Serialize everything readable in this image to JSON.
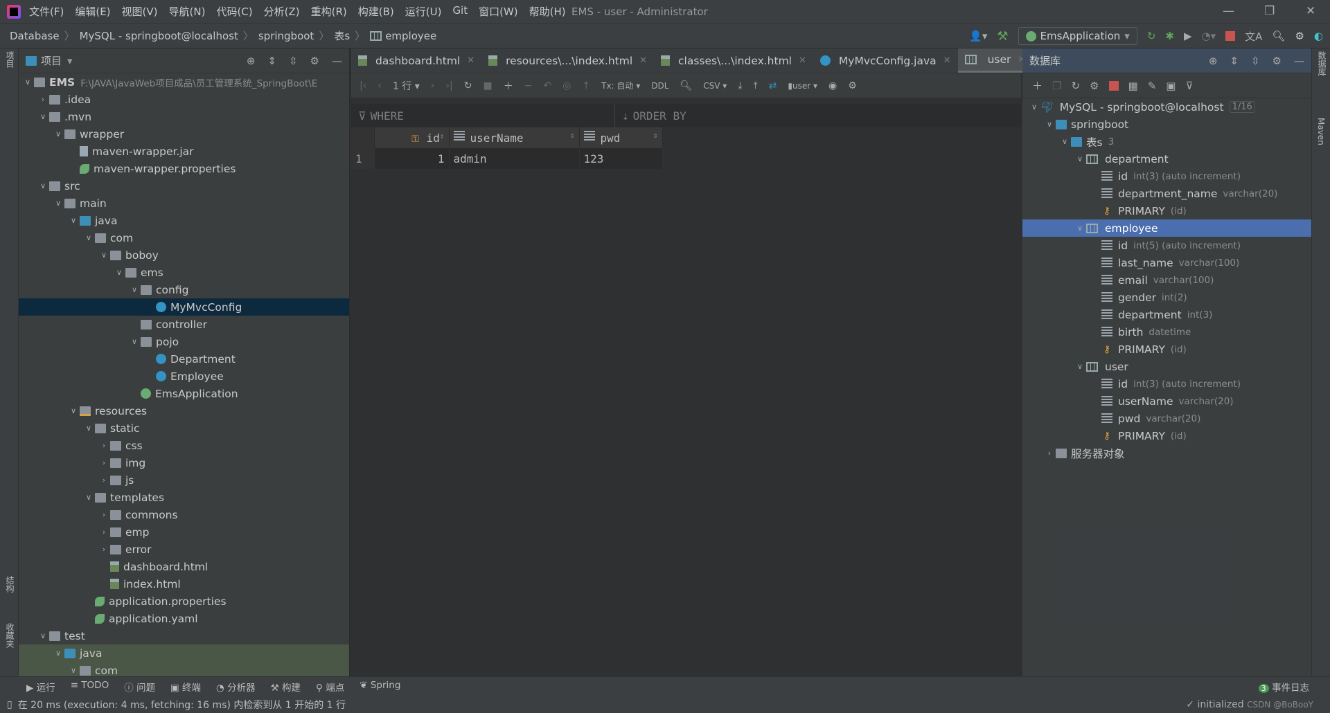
{
  "menu": [
    "文件(F)",
    "编辑(E)",
    "视图(V)",
    "导航(N)",
    "代码(C)",
    "分析(Z)",
    "重构(R)",
    "构建(B)",
    "运行(U)",
    "Git",
    "窗口(W)",
    "帮助(H)"
  ],
  "window_title": "EMS - user - Administrator",
  "breadcrumb": [
    "Database",
    "MySQL - springboot@localhost",
    "springboot",
    "表s",
    "employee"
  ],
  "run_config": "EmsApplication",
  "left_strip": {
    "project": "项目",
    "structure": "结构",
    "favorites": "收藏夹"
  },
  "right_strip": {
    "database": "数据库",
    "maven": "Maven"
  },
  "project": {
    "title": "项目",
    "root": {
      "name": "EMS",
      "path": "F:\\JAVA\\JavaWeb项目成品\\员工管理系统_SpringBoot\\E"
    },
    "items": [
      {
        "name": ".idea",
        "depth": 1,
        "type": "folder",
        "state": "collapsed"
      },
      {
        "name": ".mvn",
        "depth": 1,
        "type": "folder",
        "state": "expanded"
      },
      {
        "name": "wrapper",
        "depth": 2,
        "type": "folder",
        "state": "expanded"
      },
      {
        "name": "maven-wrapper.jar",
        "depth": 3,
        "type": "file"
      },
      {
        "name": "maven-wrapper.properties",
        "depth": 3,
        "type": "props"
      },
      {
        "name": "src",
        "depth": 1,
        "type": "folder",
        "state": "expanded"
      },
      {
        "name": "main",
        "depth": 2,
        "type": "folder",
        "state": "expanded"
      },
      {
        "name": "java",
        "depth": 3,
        "type": "srcfolder",
        "state": "expanded"
      },
      {
        "name": "com",
        "depth": 4,
        "type": "package",
        "state": "expanded"
      },
      {
        "name": "boboy",
        "depth": 5,
        "type": "package",
        "state": "expanded"
      },
      {
        "name": "ems",
        "depth": 6,
        "type": "package",
        "state": "expanded"
      },
      {
        "name": "config",
        "depth": 7,
        "type": "package",
        "state": "expanded"
      },
      {
        "name": "MyMvcConfig",
        "depth": 8,
        "type": "class",
        "selected": true
      },
      {
        "name": "controller",
        "depth": 7,
        "type": "package"
      },
      {
        "name": "pojo",
        "depth": 7,
        "type": "package",
        "state": "expanded"
      },
      {
        "name": "Department",
        "depth": 8,
        "type": "class"
      },
      {
        "name": "Employee",
        "depth": 8,
        "type": "class"
      },
      {
        "name": "EmsApplication",
        "depth": 7,
        "type": "spring"
      },
      {
        "name": "resources",
        "depth": 3,
        "type": "resfolder",
        "state": "expanded"
      },
      {
        "name": "static",
        "depth": 4,
        "type": "folder",
        "state": "expanded"
      },
      {
        "name": "css",
        "depth": 5,
        "type": "folder",
        "state": "collapsed"
      },
      {
        "name": "img",
        "depth": 5,
        "type": "folder",
        "state": "collapsed"
      },
      {
        "name": "js",
        "depth": 5,
        "type": "folder",
        "state": "collapsed"
      },
      {
        "name": "templates",
        "depth": 4,
        "type": "folder",
        "state": "expanded"
      },
      {
        "name": "commons",
        "depth": 5,
        "type": "folder",
        "state": "collapsed"
      },
      {
        "name": "emp",
        "depth": 5,
        "type": "folder",
        "state": "collapsed"
      },
      {
        "name": "error",
        "depth": 5,
        "type": "folder",
        "state": "collapsed"
      },
      {
        "name": "dashboard.html",
        "depth": 5,
        "type": "html"
      },
      {
        "name": "index.html",
        "depth": 5,
        "type": "html"
      },
      {
        "name": "application.properties",
        "depth": 4,
        "type": "props"
      },
      {
        "name": "application.yaml",
        "depth": 4,
        "type": "props"
      },
      {
        "name": "test",
        "depth": 1,
        "type": "folder",
        "state": "expanded"
      },
      {
        "name": "java",
        "depth": 2,
        "type": "srcfolder",
        "state": "expanded",
        "test": true
      },
      {
        "name": "com",
        "depth": 3,
        "type": "package",
        "state": "expanded",
        "test": true
      }
    ]
  },
  "tabs": [
    {
      "label": "dashboard.html",
      "icon": "html-file-icon"
    },
    {
      "label": "resources\\...\\index.html",
      "icon": "html-file-icon"
    },
    {
      "label": "classes\\...\\index.html",
      "icon": "html-file-icon"
    },
    {
      "label": "MyMvcConfig.java",
      "icon": "class-icon"
    },
    {
      "label": "user",
      "icon": "table-icon",
      "active": true
    }
  ],
  "grid_toolbar": {
    "rows": "1 行",
    "tx": "Tx: 自动",
    "ddl": "DDL",
    "format": "CSV",
    "schema": "user"
  },
  "filters": {
    "where": "WHERE",
    "order_by": "ORDER BY"
  },
  "grid": {
    "columns": [
      "id",
      "userName",
      "pwd"
    ],
    "rows": [
      [
        "1",
        "1",
        "admin",
        "123"
      ]
    ]
  },
  "database": {
    "title": "数据库",
    "connection": "MySQL - springboot@localhost",
    "connection_badge": "1/16",
    "schema": "springboot",
    "tables_label": "表s",
    "tables_count": "3",
    "tables": [
      {
        "name": "department",
        "columns": [
          {
            "name": "id",
            "type": "int(3) (auto increment)",
            "pk": true
          },
          {
            "name": "department_name",
            "type": "varchar(20)"
          }
        ],
        "key": {
          "name": "PRIMARY",
          "cols": "(id)"
        }
      },
      {
        "name": "employee",
        "selected": true,
        "columns": [
          {
            "name": "id",
            "type": "int(5) (auto increment)",
            "pk": true
          },
          {
            "name": "last_name",
            "type": "varchar(100)"
          },
          {
            "name": "email",
            "type": "varchar(100)"
          },
          {
            "name": "gender",
            "type": "int(2)"
          },
          {
            "name": "department",
            "type": "int(3)"
          },
          {
            "name": "birth",
            "type": "datetime"
          }
        ],
        "key": {
          "name": "PRIMARY",
          "cols": "(id)"
        }
      },
      {
        "name": "user",
        "columns": [
          {
            "name": "id",
            "type": "int(3) (auto increment)",
            "pk": true
          },
          {
            "name": "userName",
            "type": "varchar(20)"
          },
          {
            "name": "pwd",
            "type": "varchar(20)"
          }
        ],
        "key": {
          "name": "PRIMARY",
          "cols": "(id)"
        }
      }
    ],
    "server_objects": "服务器对象"
  },
  "bottom_tools": [
    "运行",
    "TODO",
    "问题",
    "终端",
    "分析器",
    "构建",
    "端点",
    "Spring"
  ],
  "event_log": {
    "count": "3",
    "label": "事件日志"
  },
  "status": {
    "message": "在 20 ms (execution: 4 ms, fetching: 16 ms) 内检索到从 1 开始的 1 行",
    "right": "initialized",
    "watermark": "CSDN @BoBooY"
  }
}
